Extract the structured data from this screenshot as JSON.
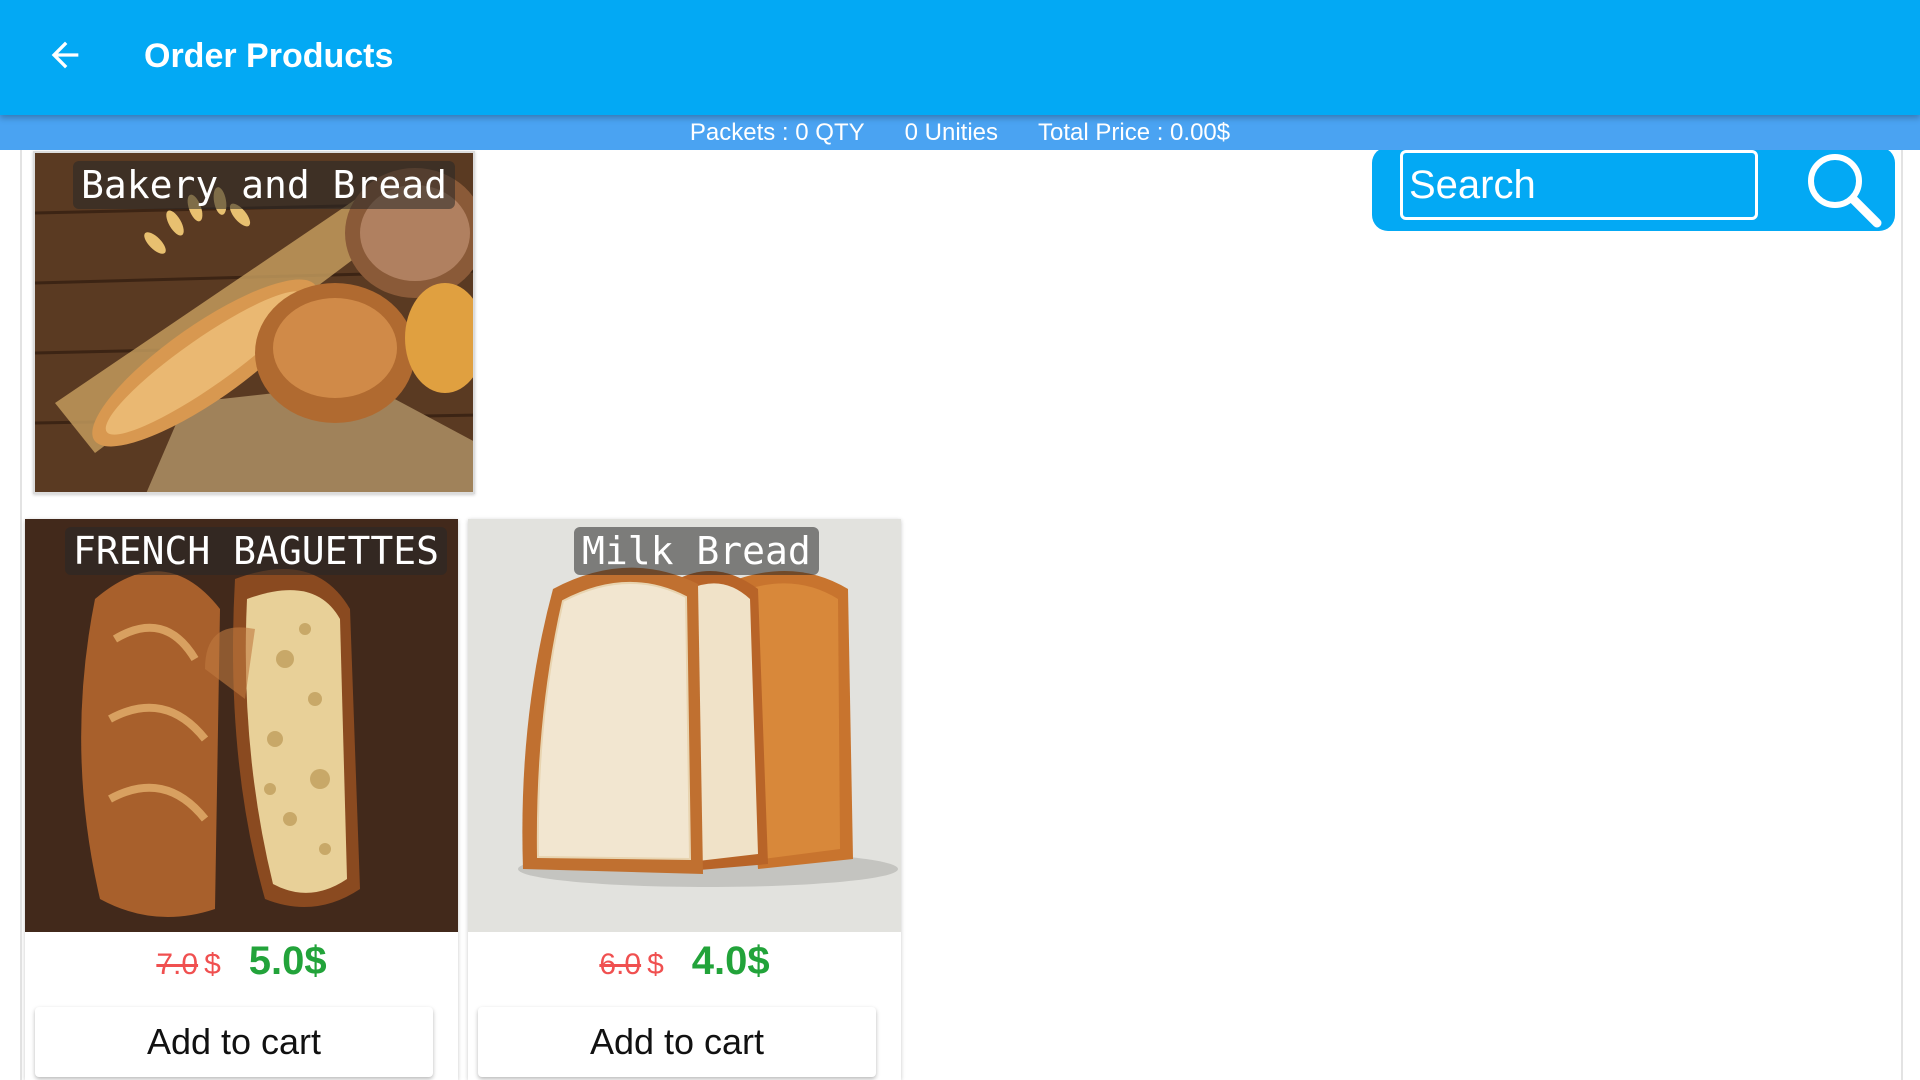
{
  "appbar": {
    "title": "Order Products",
    "back_icon": "arrow-left-icon",
    "color": "#03a9f4"
  },
  "summary": {
    "packets": "Packets : 0 QTY",
    "unities": "0 Unities",
    "total": "Total Price : 0.00$",
    "color": "#4aa3f2"
  },
  "category": {
    "label": "Bakery and Bread"
  },
  "search": {
    "placeholder": "Search",
    "icon": "search-icon"
  },
  "products": [
    {
      "name": "FRENCH BAGUETTES",
      "old_price": "7.0",
      "currency": "$",
      "new_price": "5.0$",
      "button": "Add to cart"
    },
    {
      "name": "Milk Bread",
      "old_price": "6.0",
      "currency": "$",
      "new_price": "4.0$",
      "button": "Add to cart"
    }
  ],
  "colors": {
    "old_price": "#f05050",
    "new_price": "#22a33a"
  }
}
